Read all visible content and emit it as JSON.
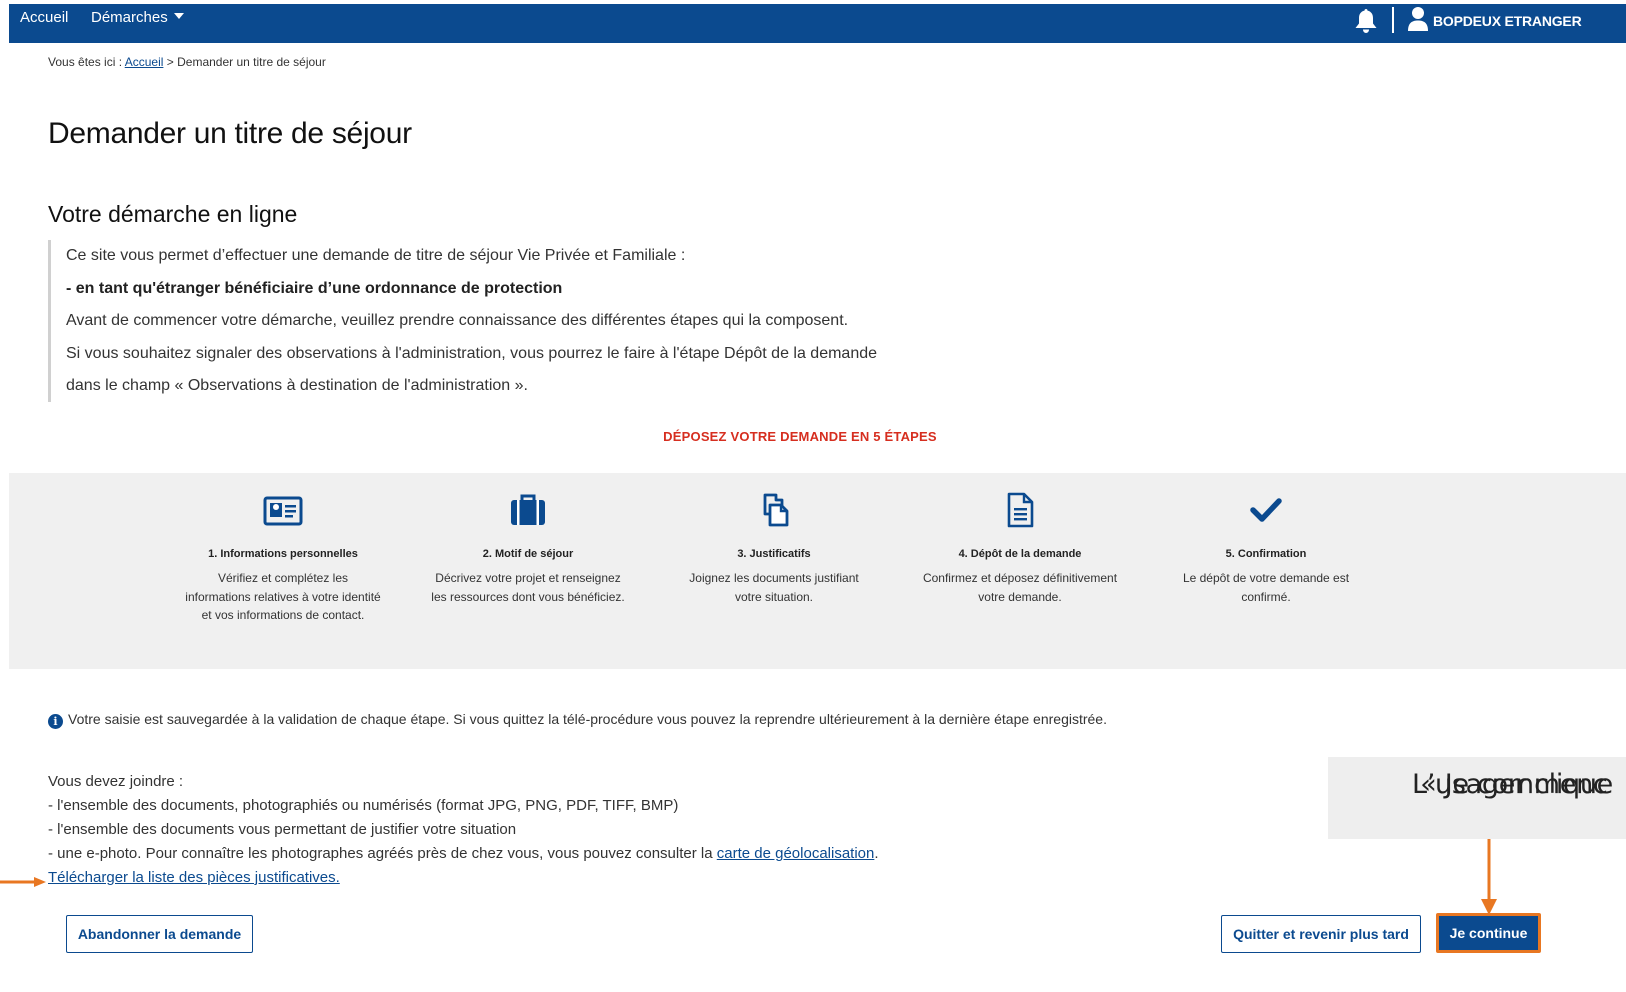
{
  "nav": {
    "home": "Accueil",
    "demarches": "Démarches",
    "user": "BOPDEUX ETRANGER"
  },
  "breadcrumb": {
    "prefix": "Vous êtes ici :",
    "home": "Accueil",
    "separator": ">",
    "current": "Demander un titre de séjour"
  },
  "page_title": "Demander un titre de séjour",
  "section_title": "Votre démarche en ligne",
  "intro": [
    "Ce site vous permet d’effectuer une demande de titre de séjour Vie Privée et Familiale :",
    "- en tant qu'étranger bénéficiaire d’une ordonnance de protection",
    "Avant de commencer votre démarche, veuillez prendre connaissance des différentes étapes qui la composent.",
    "Si vous souhaitez signaler des observations à l'administration, vous pourrez le faire à l'étape Dépôt de la demande",
    "dans le champ « Observations à destination de l'administration »."
  ],
  "steps_title": "DÉPOSEZ VOTRE DEMANDE EN 5 ÉTAPES",
  "steps": [
    {
      "icon": "id-card-icon",
      "title": "1. Informations personnelles",
      "desc": [
        "Vérifiez et complétez les",
        "informations relatives à votre identité",
        "et vos informations de contact."
      ]
    },
    {
      "icon": "briefcase-icon",
      "title": "2. Motif de séjour",
      "desc": [
        "Décrivez votre projet et renseignez",
        "les ressources dont vous bénéficiez."
      ]
    },
    {
      "icon": "documents-icon",
      "title": "3. Justificatifs",
      "desc": [
        "Joignez les documents justifiant",
        "votre situation."
      ]
    },
    {
      "icon": "file-icon",
      "title": "4. Dépôt de la demande",
      "desc": [
        "Confirmez et déposez définitivement",
        "votre demande."
      ]
    },
    {
      "icon": "check-icon",
      "title": "5. Confirmation",
      "desc": [
        "Le dépôt de votre demande est",
        "confirmé."
      ]
    }
  ],
  "info": "Votre saisie est sauvegardée à la validation de chaque étape. Si vous quittez la télé-procédure vous pouvez la reprendre ultérieurement à la dernière étape enregistrée.",
  "requirements": {
    "heading": "Vous devez joindre :",
    "item1": "- l'ensemble des documents, photographiés ou numérisés (format JPG, PNG, PDF, TIFF, BMP)",
    "item2": "- l'ensemble des documents vous permettant de justifier votre situation",
    "item3_prefix": "- une e-photo. Pour connaître les photographes agréés près de chez vous, vous pouvez consulter la",
    "item3_link": "carte de géolocalisation",
    "item3_suffix": ".",
    "download_link": "Télécharger la liste des pièces justificatives."
  },
  "buttons": {
    "abandon": "Abandonner la demande",
    "quit": "Quitter et revenir plus tard",
    "continue": "Je continue"
  },
  "annotation": {
    "line1": "L’usager clique",
    "line2": " « Je commenc"
  },
  "colors": {
    "brand_blue": "#0b4a8f",
    "highlight_orange": "#e87722",
    "steps_title_red": "#d62e1f",
    "band_gray": "#f0f0f0"
  }
}
